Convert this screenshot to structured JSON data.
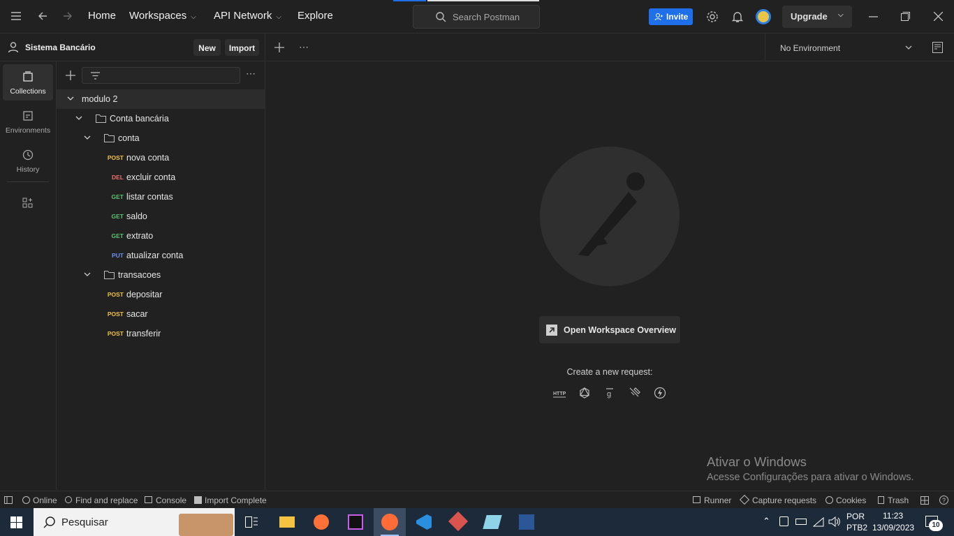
{
  "nav": {
    "home": "Home",
    "workspaces": "Workspaces",
    "api_network": "API Network",
    "explore": "Explore"
  },
  "search": {
    "placeholder": "Search Postman"
  },
  "topright": {
    "invite": "Invite",
    "upgrade": "Upgrade"
  },
  "workspace": {
    "name": "Sistema Bancário",
    "new_label": "New",
    "import_label": "Import"
  },
  "rail": [
    {
      "label": "Collections"
    },
    {
      "label": "Environments"
    },
    {
      "label": "History"
    }
  ],
  "tree": {
    "collection": "modulo 2",
    "folder": "Conta bancária",
    "sub1": "conta",
    "sub2": "transacoes",
    "requests": [
      {
        "method": "POST",
        "name": "nova conta",
        "color": "#f0c040"
      },
      {
        "method": "DEL",
        "name": "excluir conta",
        "color": "#f07070"
      },
      {
        "method": "GET",
        "name": "listar contas",
        "color": "#5bc46f"
      },
      {
        "method": "GET",
        "name": "saldo",
        "color": "#5bc46f"
      },
      {
        "method": "GET",
        "name": "extrato",
        "color": "#5bc46f"
      },
      {
        "method": "PUT",
        "name": "atualizar conta",
        "color": "#6b8ff0"
      },
      {
        "method": "POST",
        "name": "depositar",
        "color": "#f0c040"
      },
      {
        "method": "POST",
        "name": "sacar",
        "color": "#f0c040"
      },
      {
        "method": "POST",
        "name": "transferir",
        "color": "#f0c040"
      }
    ]
  },
  "environment": {
    "selected": "No Environment"
  },
  "main": {
    "overview_button": "Open Workspace Overview",
    "create_label": "Create a new request:"
  },
  "watermark": {
    "title": "Ativar o Windows",
    "subtitle": "Acesse Configurações para ativar o Windows."
  },
  "statusbar": {
    "online": "Online",
    "find": "Find and replace",
    "console": "Console",
    "import": "Import Complete",
    "runner": "Runner",
    "capture": "Capture requests",
    "cookies": "Cookies",
    "trash": "Trash"
  },
  "taskbar": {
    "search": "Pesquisar",
    "lang1": "POR",
    "lang2": "PTB2",
    "time": "11:23",
    "date": "13/09/2023",
    "notif_count": "10"
  }
}
